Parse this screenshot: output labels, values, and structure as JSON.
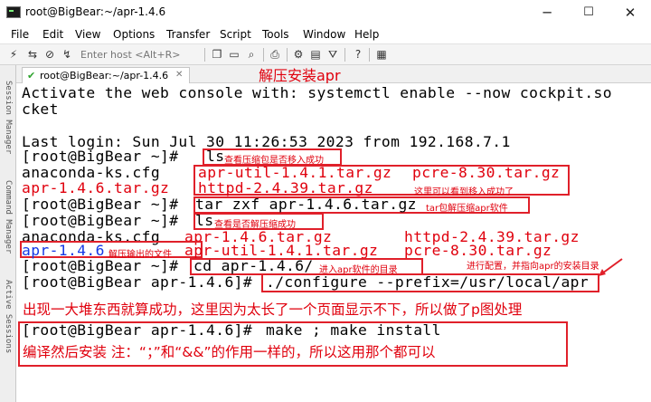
{
  "window": {
    "title": "root@BigBear:~/apr-1.4.6",
    "controls": {
      "minimize": "─",
      "maximize": "☐",
      "close": "✕"
    }
  },
  "menu": [
    "File",
    "Edit",
    "View",
    "Options",
    "Transfer",
    "Script",
    "Tools",
    "Window",
    "Help"
  ],
  "toolbar": {
    "host_placeholder": "Enter host <Alt+R>",
    "icons": [
      "lightning-icon",
      "connect-icon",
      "disconnect-icon",
      "copy-icon",
      "paste-icon",
      "find-icon",
      "print-icon",
      "settings-icon",
      "sftp-icon",
      "keymap-icon",
      "help-icon",
      "keypad-icon"
    ]
  },
  "sidebar": {
    "tabs": [
      "Session Manager",
      "Command Manager",
      "Active Sessions"
    ]
  },
  "tab": {
    "label": "root@BigBear:~/apr-1.4.6",
    "close": "✕"
  },
  "header_annotation": "解压安装apr",
  "terminal": {
    "l1": "Activate the web console with: systemctl enable --now cockpit.so",
    "l2": "cket",
    "l3": "Last login: Sun Jul 30 11:26:53 2023 from 192.168.7.1",
    "l4_prompt": "[root@BigBear ~]#",
    "l4_cmd": "ls",
    "l4_note": "查看压缩包是否移入成功",
    "l5_a": "anaconda-ks.cfg",
    "l5_b": "apr-util-1.4.1.tar.gz",
    "l5_c": "pcre-8.30.tar.gz",
    "l6_a": "apr-1.4.6.tar.gz",
    "l6_b": "httpd-2.4.39.tar.gz",
    "l6_note": "这里可以看到移入成功了",
    "l7_prompt": "[root@BigBear ~]#",
    "l7_cmd": "tar zxf apr-1.4.6.tar.gz",
    "l7_note": "tar包解压缩apr软件",
    "l8_prompt": "[root@BigBear ~]#",
    "l8_cmd": "ls",
    "l8_note": "查看是否解压缩成功",
    "l9_a": "anaconda-ks.cfg",
    "l9_b": "apr-1.4.6.tar.gz",
    "l9_c": "httpd-2.4.39.tar.gz",
    "l10_a": "apr-1.4.6",
    "l10_note": "解压输出的文件",
    "l10_b": "apr-util-1.4.1.tar.gz",
    "l10_c": "pcre-8.30.tar.gz",
    "l11_prompt": "[root@BigBear ~]#",
    "l11_cmd": "cd apr-1.4.6/",
    "l11_note": "进入apr软件的目录",
    "l11_note2": "进行配置，并指向apr的安装目录",
    "l12_prompt": "[root@BigBear apr-1.4.6]#",
    "l12_cmd": "./configure --prefix=/usr/local/apr",
    "note_big1": "出现一大堆东西就算成功，这里因为太长了一个页面显示不下，所以做了p图处理",
    "l13_prompt": "[root@BigBear apr-1.4.6]#",
    "l13_cmd": "make ; make install",
    "note_big2": "编译然后安装    注：“；”和“&&”的作用一样的，所以这用那个都可以"
  },
  "colors": {
    "annotation_red": "#e0000d",
    "file_red": "#e0000d",
    "dir_blue": "#1437e6",
    "box_red": "#e0202a"
  }
}
